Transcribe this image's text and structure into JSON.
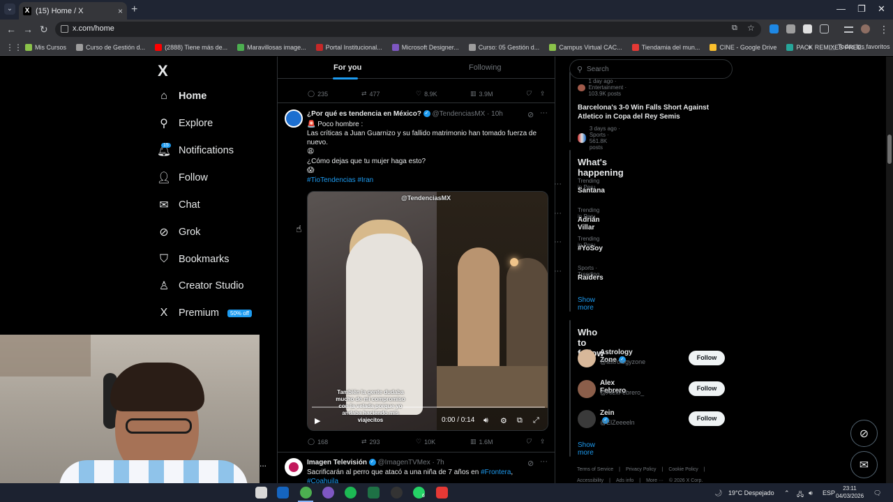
{
  "browser": {
    "tab_title": "(15) Home / X",
    "url": "x.com/home",
    "bookmarks": [
      {
        "label": "Mis Cursos",
        "color": "#8bc34a"
      },
      {
        "label": "Curso de Gestión d...",
        "color": "#9e9e9e"
      },
      {
        "label": "(2888) Tiene más de...",
        "color": "#ff0000"
      },
      {
        "label": "Maravillosas image...",
        "color": "#4caf50"
      },
      {
        "label": "Portal Institucional...",
        "color": "#c62828"
      },
      {
        "label": "Microsoft Designer...",
        "color": "#7e57c2"
      },
      {
        "label": "Curso: 05 Gestión d...",
        "color": "#9e9e9e"
      },
      {
        "label": "Campus Virtual CAC...",
        "color": "#8bc34a"
      },
      {
        "label": "Tiendamia del mun...",
        "color": "#e53935"
      },
      {
        "label": "CINE - Google Drive",
        "color": "#fbc02d"
      },
      {
        "label": "PACK REMIXES FREE...",
        "color": "#26a69a"
      }
    ],
    "bookmarks_more": "»",
    "all_favorites": "Todos los favoritos"
  },
  "sidebar": {
    "logo": "X",
    "notifications_badge": "15",
    "items": [
      {
        "label": "Home",
        "icon": "home-icon",
        "glyph": "⌂"
      },
      {
        "label": "Explore",
        "icon": "search-icon",
        "glyph": "⚲"
      },
      {
        "label": "Notifications",
        "icon": "bell-icon",
        "glyph": "🔔︎"
      },
      {
        "label": "Follow",
        "icon": "person-plus-icon",
        "glyph": "👤︎"
      },
      {
        "label": "Chat",
        "icon": "mail-icon",
        "glyph": "✉"
      },
      {
        "label": "Grok",
        "icon": "grok-icon",
        "glyph": "⊘"
      },
      {
        "label": "Bookmarks",
        "icon": "bookmark-icon",
        "glyph": "⛉"
      },
      {
        "label": "Creator Studio",
        "icon": "creator-studio-icon",
        "glyph": "♙"
      },
      {
        "label": "Premium",
        "icon": "x-premium-icon",
        "glyph": "X"
      }
    ],
    "premium_badge": "50% off",
    "more": "..."
  },
  "feed": {
    "tabs": {
      "for_you": "For you",
      "following": "Following"
    },
    "prev_actions": {
      "replies": "235",
      "reposts": "477",
      "likes": "8.9K",
      "views": "3.9M"
    },
    "tweet1": {
      "name": "¿Por qué es tendencia en México?",
      "handle": "@TendenciasMX",
      "time": "10h",
      "line1": "🚨 Poco hombre :",
      "line2": "Las críticas a Juan Guarnizo y su fallido matrimonio han tomado fuerza de",
      "line3": "nuevo.",
      "line4": "😩",
      "line5": "¿Cómo dejas que tu mujer haga esto?",
      "line6": "😱",
      "hashtags": "#TioTendencias #Iran",
      "video_watermark": "@TendenciasMX",
      "video_caption": "También la gente dudaba mucho de mi compromiso con la velada porque yo andaba haciendo mis viajecitos",
      "video_time": "0:00 / 0:14",
      "video_progress": 0.0,
      "replies": "168",
      "reposts": "293",
      "likes": "10K",
      "views": "1.6M"
    },
    "tweet2": {
      "name": "Imagen Televisión",
      "handle": "@ImagenTVMex",
      "time": "7h",
      "text_before": "Sacrificarán al perro que atacó a una niña de 7 años en",
      "hashtag1": "#Frontera",
      "text_after": ",",
      "hashtag2": "#Coahuila"
    }
  },
  "right": {
    "search_placeholder": "Search",
    "partial_trend_meta": "1 day ago · Entertainment · 103.9K posts",
    "news": {
      "title": "Barcelona's 3-0 Win Falls Short Against Atletico in Copa del Rey Semis",
      "meta": "3 days ago · Sports · 561.8K posts"
    },
    "happening_title": "What's happening",
    "trends": [
      {
        "context": "Trending in Peru",
        "name": "Santana"
      },
      {
        "context": "Trending in Peru",
        "name": "Adrián Villar"
      },
      {
        "context": "Trending in Peru",
        "name": "#YoSoy"
      },
      {
        "context": "Sports · Trending",
        "name": "Raiders"
      }
    ],
    "show_more": "Show more",
    "who_to_follow_title": "Who to follow",
    "follow_suggestions": [
      {
        "name": "Astrology Zone",
        "handle": "@astrologyzone",
        "verified": true,
        "avatar_color": "#d8b89a"
      },
      {
        "name": "Alex Febrero",
        "handle": "@AlexFebrero_",
        "verified": false,
        "avatar_color": "#8b5e4a"
      },
      {
        "name": "Zein",
        "handle": "@ElZeeeeln",
        "verified": true,
        "avatar_color": "#3a3a3a"
      }
    ],
    "follow_label": "Follow",
    "footer_links": [
      "Terms of Service",
      "|",
      "Privacy Policy",
      "|",
      "Cookie Policy",
      "|"
    ],
    "footer_links2": [
      "Accessibility",
      "|",
      "Ads info",
      "|",
      "More ···",
      "© 2026 X Corp."
    ]
  },
  "taskbar": {
    "weather": "19°C  Despejado",
    "lang": "ESP",
    "time": "23:11",
    "date": "04/03/2026",
    "whatsapp_badge": "6"
  }
}
